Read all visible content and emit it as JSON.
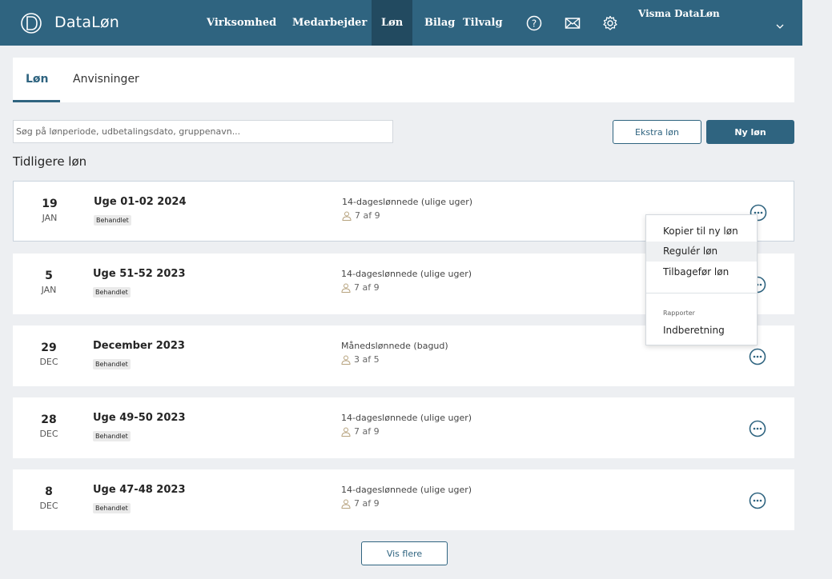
{
  "colors": {
    "nav_bg": "#2f6480",
    "nav_active_bg": "#224a60",
    "accent": "#2f6480",
    "page_bg": "#edeff2"
  },
  "header": {
    "brand": "DataLøn",
    "logo_icon": "dataloen-logo-icon",
    "nav": [
      {
        "label": "Virksomhed"
      },
      {
        "label": "Medarbejder"
      },
      {
        "label": "Løn",
        "active": true
      },
      {
        "label": "Bilag"
      },
      {
        "label": "Tilvalg"
      }
    ],
    "icons": [
      "help-icon",
      "mail-icon",
      "settings-icon"
    ],
    "user": "Visma DataLøn"
  },
  "tabs": [
    {
      "label": "Løn",
      "active": true
    },
    {
      "label": "Anvisninger"
    }
  ],
  "search": {
    "placeholder": "Søg på lønperiode, udbetalingsdato, gruppenavn..."
  },
  "buttons": {
    "extra": "Ekstra løn",
    "new": "Ny løn",
    "more": "Vis flere"
  },
  "section_title": "Tidligere løn",
  "runs": [
    {
      "day": "19",
      "month": "JAN",
      "title": "Uge 01-02 2024",
      "status": "Behandlet",
      "group": "14-dageslønnede (ulige uger)",
      "count": "7 af 9"
    },
    {
      "day": "5",
      "month": "JAN",
      "title": "Uge 51-52 2023",
      "status": "Behandlet",
      "group": "14-dageslønnede (ulige uger)",
      "count": "7 af 9"
    },
    {
      "day": "29",
      "month": "DEC",
      "title": "December 2023",
      "status": "Behandlet",
      "group": "Månedslønnede (bagud)",
      "count": "3 af 5"
    },
    {
      "day": "28",
      "month": "DEC",
      "title": "Uge 49-50 2023",
      "status": "Behandlet",
      "group": "14-dageslønnede (ulige uger)",
      "count": "7 af 9"
    },
    {
      "day": "8",
      "month": "DEC",
      "title": "Uge 47-48 2023",
      "status": "Behandlet",
      "group": "14-dageslønnede (ulige uger)",
      "count": "7 af 9"
    }
  ],
  "context_menu": {
    "items": [
      "Kopier til ny løn",
      "Regulér løn",
      "Tilbagefør løn"
    ],
    "heading": "Rapporter",
    "report_items": [
      "Indberetning"
    ]
  }
}
